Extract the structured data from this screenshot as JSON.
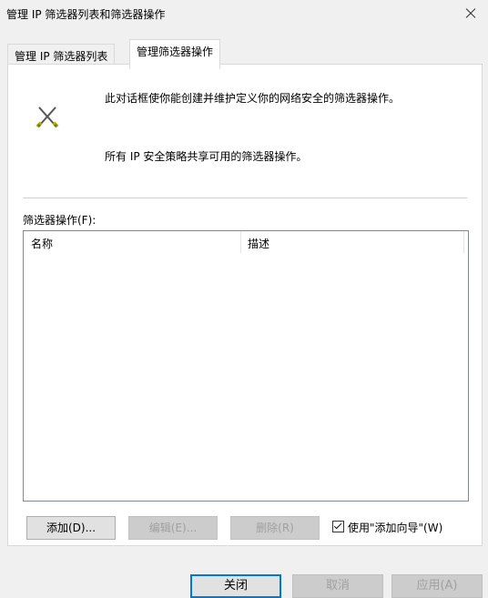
{
  "window": {
    "title": "管理 IP 筛选器列表和筛选器操作"
  },
  "tabs": [
    {
      "label": "管理 IP 筛选器列表"
    },
    {
      "label": "管理筛选器操作"
    }
  ],
  "panel": {
    "description_1": "此对话框使你能创建并维护定义你的网络安全的筛选器操作。",
    "description_2": "所有 IP 安全策略共享可用的筛选器操作。",
    "list_label": "筛选器操作(F):",
    "columns": [
      "名称",
      "描述"
    ],
    "rows": [],
    "buttons": {
      "add": "添加(D)...",
      "edit": "编辑(E)...",
      "remove": "删除(R)"
    },
    "wizard_checkbox": {
      "label": "使用\"添加向导\"(W)",
      "checked": true
    }
  },
  "footer": {
    "close": "关闭",
    "cancel": "取消",
    "apply": "应用(A)"
  },
  "colors": {
    "accent": "#0078d7",
    "panel_bg": "#ffffff",
    "window_bg": "#f0f0f0"
  }
}
